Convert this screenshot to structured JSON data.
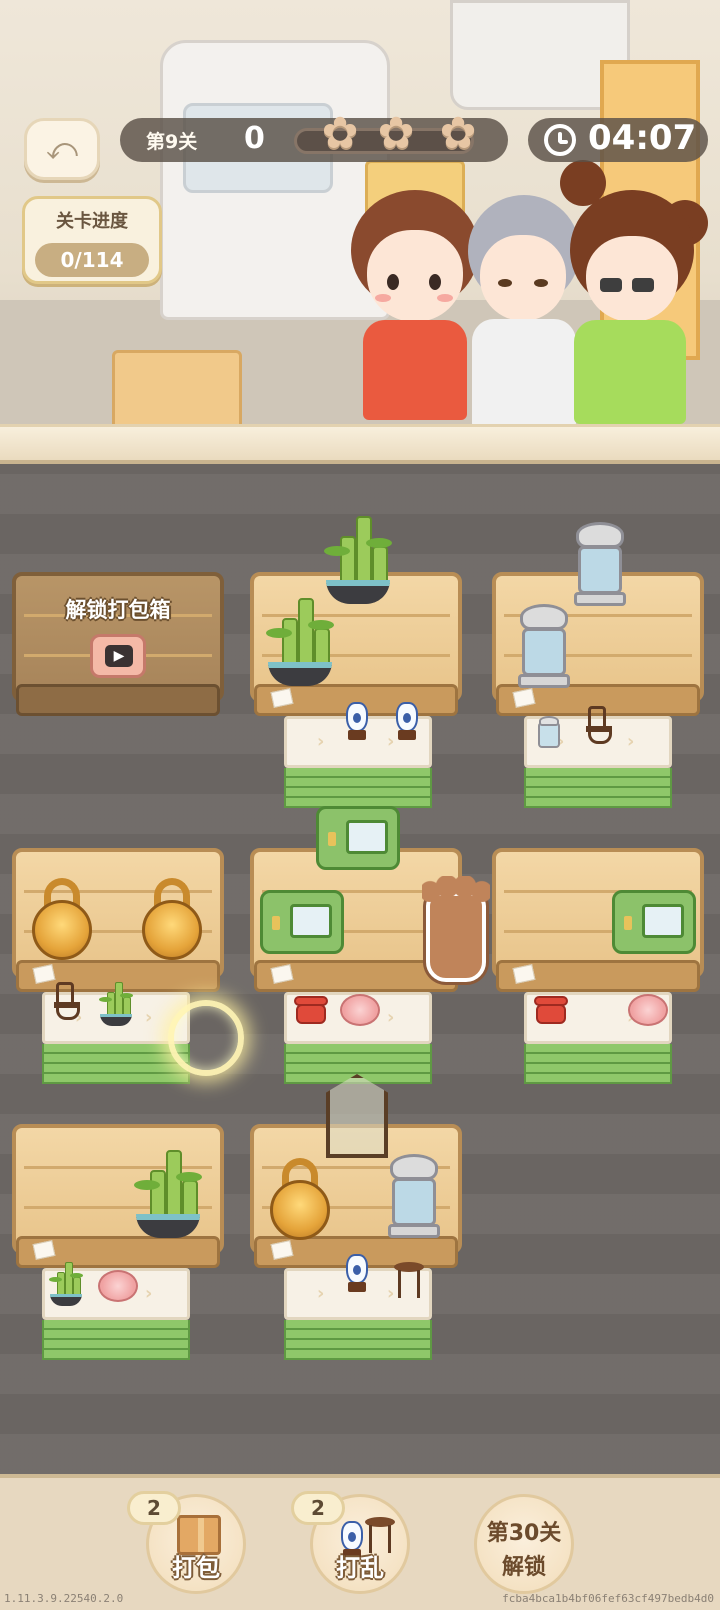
{
  "hud": {
    "level_label": "第9关",
    "score": "0",
    "stars_earned": 0,
    "stars_total": 3,
    "timer": "04:07",
    "progress_title": "关卡进度",
    "progress_value": "0/114"
  },
  "board": {
    "locked_shelf_label": "解锁打包箱"
  },
  "toolbar": {
    "pack_label": "打包",
    "pack_count": "2",
    "shuffle_label": "打乱",
    "shuffle_count": "2",
    "unlock_line1": "第30关",
    "unlock_line2": "解锁"
  },
  "footer": {
    "version": "1.11.3.9.22540.2.0",
    "build_hash": "fcba4bca1b4bf06fef63cf497bedb4d0"
  },
  "icons": {
    "back": "back-arrow-icon",
    "clock": "clock-icon",
    "star": "star-icon",
    "play": "video-play-icon",
    "hand": "paw-pointer-icon"
  },
  "colors": {
    "hud_pill": "#5a5048",
    "shelf_wood": "#e8c48a",
    "queue_stack": "#8fc86a",
    "bottom_bar": "#e7d8c0"
  }
}
